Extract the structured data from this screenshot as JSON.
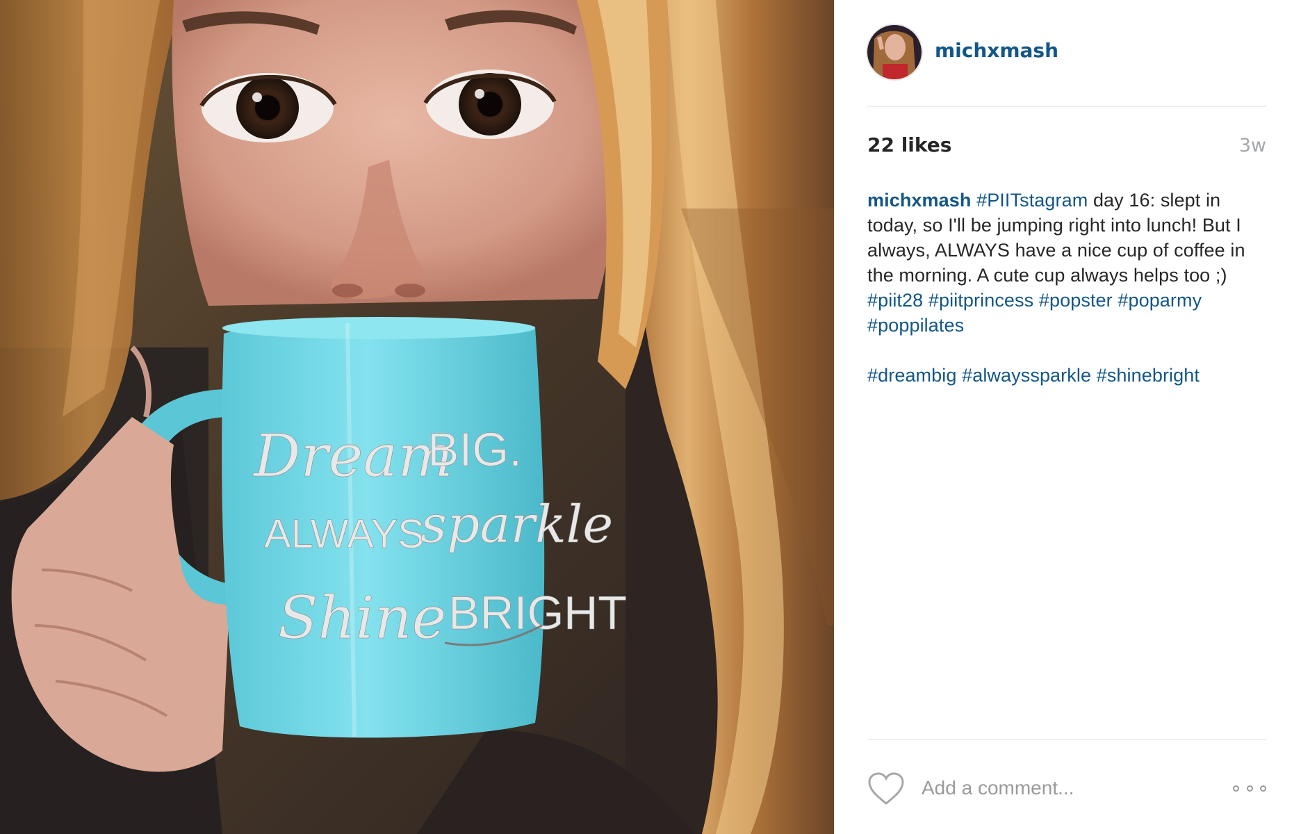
{
  "post": {
    "photo": {
      "alt": "Selfie of a woman drinking from a light blue mug",
      "mug_text": {
        "line1_script": "Dream",
        "line1_caps": "BIG.",
        "line2_caps": "ALWAYS",
        "line2_script": "sparkle",
        "line3_script": "Shine",
        "line3_caps": "BRIGHT"
      }
    },
    "header": {
      "username": "michxmash",
      "avatar_icon": "profile-avatar"
    },
    "meta": {
      "likes": "22 likes",
      "time": "3w"
    },
    "caption": {
      "user": "michxmash",
      "tag1": "#PIITstagram",
      "text1": " day 16: slept in today, so I'll be jumping right into lunch! But I always, ALWAYS have a nice cup of coffee in the morning. A cute cup always helps too ;) ",
      "tags2": [
        "#piit28",
        "#piitprincess",
        "#popster",
        "#poparmy",
        "#poppilates"
      ],
      "tags3": [
        "#dreambig",
        "#alwayssparkle",
        "#shinebright"
      ]
    },
    "footer": {
      "like_icon": "heart-icon",
      "comment_placeholder": "Add a comment...",
      "more_icon": "more-options-icon"
    }
  },
  "colors": {
    "link": "#125688",
    "text": "#262626",
    "muted": "#a5a7aa",
    "divider": "#efefef",
    "mug": "#6fd6e6"
  }
}
